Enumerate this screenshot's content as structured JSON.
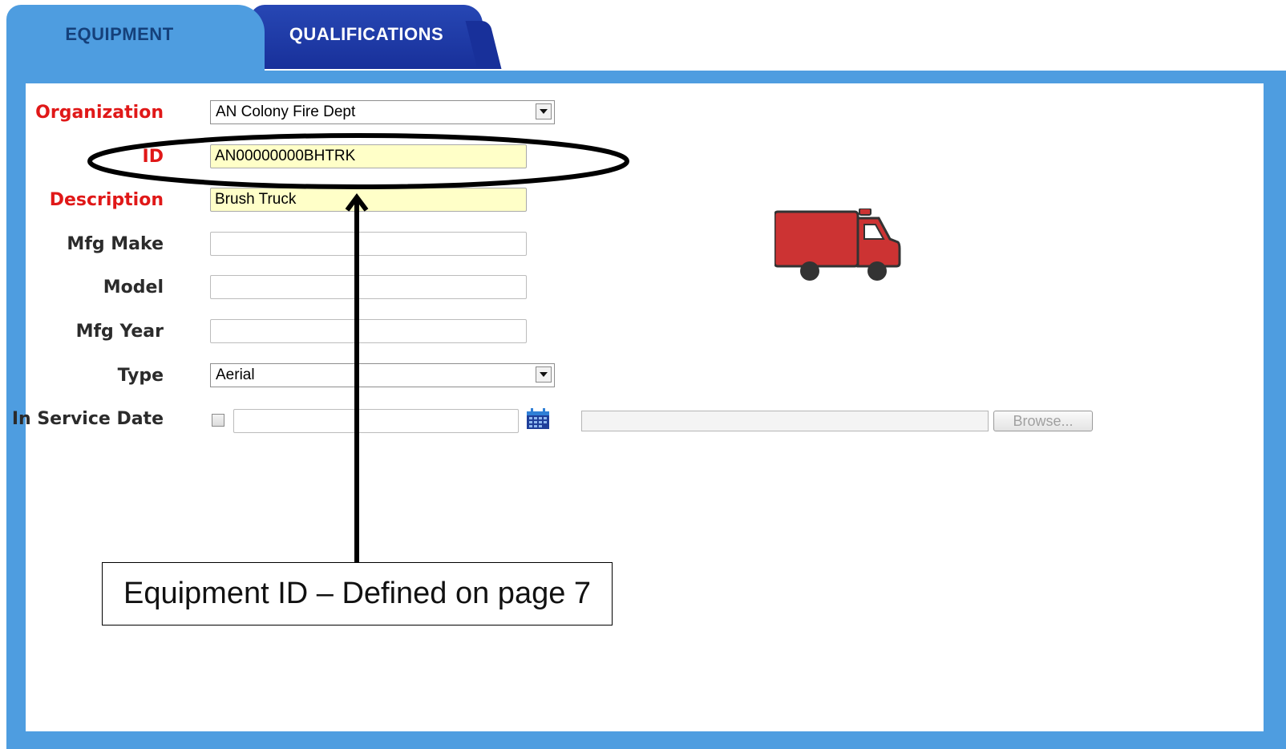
{
  "tabs": {
    "equipment": "EQUIPMENT",
    "qualifications": "QUALIFICATIONS"
  },
  "form": {
    "organization": {
      "label": "Organization",
      "value": "AN Colony Fire Dept"
    },
    "id": {
      "label": "ID",
      "value": "AN00000000BHTRK"
    },
    "description": {
      "label": "Description",
      "value": "Brush Truck"
    },
    "mfg_make": {
      "label": "Mfg Make",
      "value": ""
    },
    "model": {
      "label": "Model",
      "value": ""
    },
    "mfg_year": {
      "label": "Mfg Year",
      "value": ""
    },
    "type": {
      "label": "Type",
      "value": "Aerial"
    },
    "in_service_date": {
      "label": "In Service Date",
      "value": ""
    }
  },
  "upload": {
    "browse_label": "Browse..."
  },
  "callout": {
    "text": "Equipment ID – Defined on page 7"
  },
  "icons": {
    "truck": "fire-truck-icon",
    "calendar": "calendar-icon",
    "dropdown": "chevron-down-icon"
  },
  "colors": {
    "panel_blue": "#4e9de0",
    "tab_active_text": "#15407a",
    "tab_inactive_bg": "#1f3aa8",
    "required_label": "#e01818",
    "highlight_field": "#ffffc8",
    "truck_red": "#cc3333"
  }
}
